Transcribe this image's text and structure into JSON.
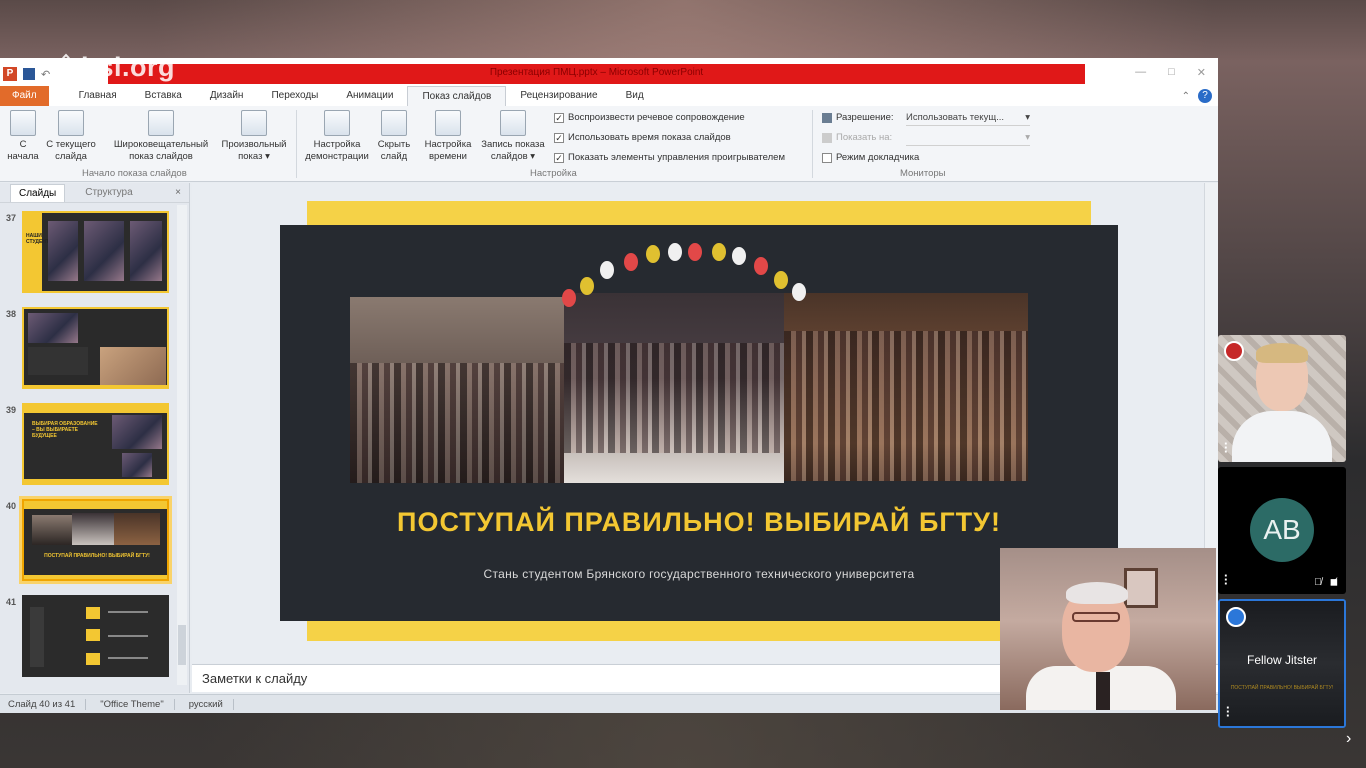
{
  "app": {
    "watermark": "itsi.org"
  },
  "window": {
    "title": "Презентация ПМЦ.pptx – Microsoft PowerPoint",
    "buttons": [
      "—",
      "□",
      "✕"
    ]
  },
  "quick_access": {
    "app_icon": "P"
  },
  "menu": {
    "file": "Файл",
    "tabs": [
      "Главная",
      "Вставка",
      "Дизайн",
      "Переходы",
      "Анимации",
      "Показ слайдов",
      "Рецензирование",
      "Вид"
    ],
    "active_tab": "Показ слайдов"
  },
  "ribbon": {
    "buttons": [
      "С начала",
      "С текущего слайда",
      "Широковещательный показ слайдов",
      "Произвольный показ ▾",
      "Настройка демонстрации",
      "Скрыть слайд",
      "Настройка времени",
      "Запись показа слайдов ▾"
    ],
    "groups": [
      "Начало показа слайдов",
      "Настройка",
      "Мониторы"
    ],
    "checks": [
      {
        "label": "Воспроизвести речевое сопровождение",
        "checked": true
      },
      {
        "label": "Использовать время показа слайдов",
        "checked": true
      },
      {
        "label": "Показать элементы управления проигрывателем",
        "checked": true
      }
    ],
    "monitors": {
      "resolution_label": "Разрешение:",
      "resolution_value": "Использовать текущ...",
      "show_on_label": "Показать на:",
      "presenter_view": "Режим докладчика"
    }
  },
  "left_pane": {
    "tabs": [
      "Слайды",
      "Структура"
    ],
    "close": "×",
    "thumbs": [
      {
        "num": "37",
        "text": "НАШИ СТУДЕНТЫ"
      },
      {
        "num": "38",
        "text": ""
      },
      {
        "num": "39",
        "text": "ВЫБИРАЯ ОБРАЗОВАНИЕ – ВЫ ВЫБИРАЕТЕ БУДУЩЕЕ"
      },
      {
        "num": "40",
        "text": "ПОСТУПАЙ ПРАВИЛЬНО! ВЫБИРАЙ БГТУ!"
      },
      {
        "num": "41",
        "text": ""
      }
    ]
  },
  "slide": {
    "title": "ПОСТУПАЙ ПРАВИЛЬНО! ВЫБИРАЙ БГТУ!",
    "subtitle": "Стань студентом Брянского государственного технического университета"
  },
  "notes": {
    "placeholder": "Заметки к слайду"
  },
  "status": {
    "slide": "Слайд 40 из 41",
    "theme": "\"Office Theme\"",
    "lang": "русский"
  },
  "participants": [
    {
      "id": "p1",
      "initials": ""
    },
    {
      "id": "p2",
      "initials": "AB"
    },
    {
      "id": "p3",
      "name": "Fellow Jitster",
      "preview": "ПОСТУПАЙ ПРАВИЛЬНО! ВЫБИРАЙ БГТУ!"
    }
  ],
  "colors": {
    "accent_yellow": "#f3c732",
    "slide_bg": "#262a30",
    "ppt_red": "#e01818",
    "file_tab": "#e26b2a",
    "jitsi_blue": "#2b77d9",
    "avatar": "#2c6b66"
  },
  "icons": {
    "next": "chevron-right-icon",
    "muted_mic": "mic-off-icon",
    "video_off": "camera-off-icon"
  }
}
